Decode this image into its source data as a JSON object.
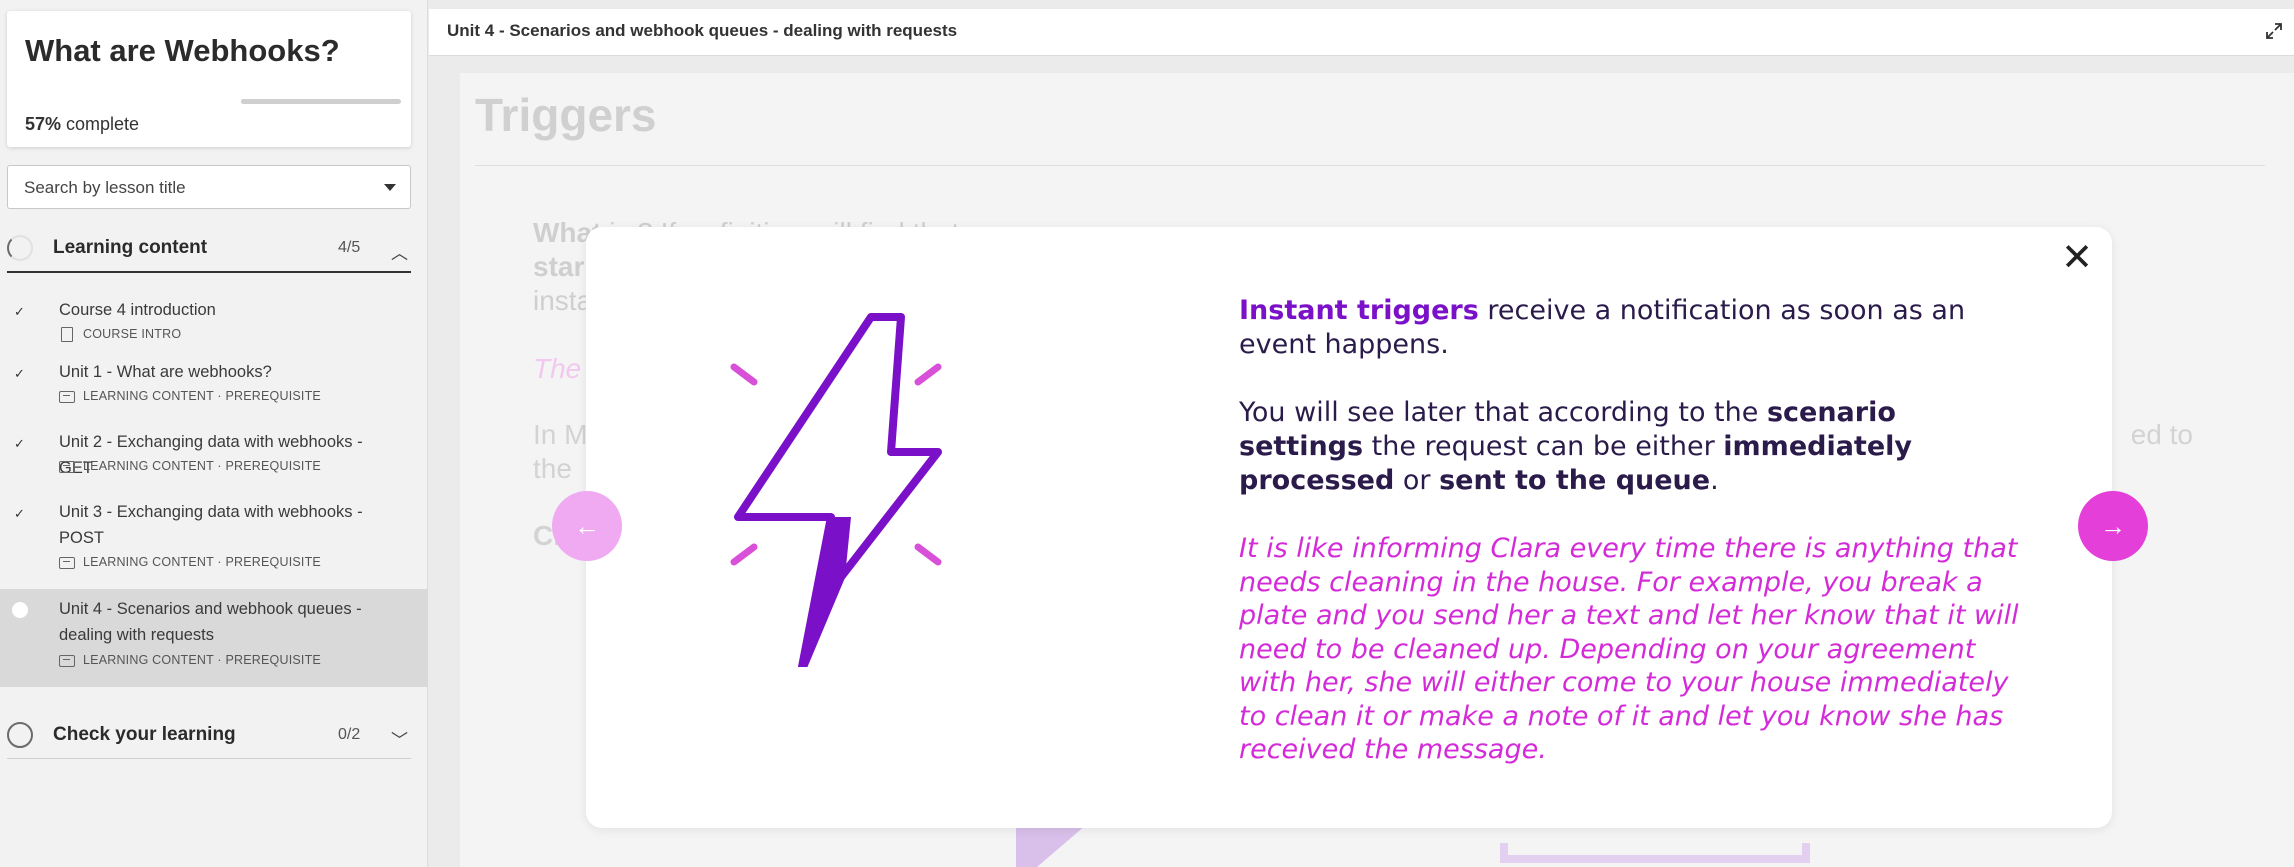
{
  "sidebar": {
    "course_title": "What are Webhooks?",
    "progress_percent": 57,
    "progress_value": "57%",
    "progress_suffix": " complete",
    "search_placeholder": "Search by lesson title",
    "sections": [
      {
        "label": "Learning content",
        "count": "4/5",
        "chevron": "chevron-up-icon",
        "chevron_glyph": "︿"
      },
      {
        "label": "Check your learning",
        "count": "0/2",
        "chevron": "chevron-down-icon",
        "chevron_glyph": "﹀"
      }
    ],
    "lessons": [
      {
        "title": "Course 4 introduction",
        "meta": "COURSE INTRO",
        "status": "complete",
        "icon": "document-icon"
      },
      {
        "title": "Unit 1 - What are webhooks?",
        "meta": "LEARNING CONTENT · PREREQUISITE",
        "status": "complete",
        "icon": "slides-icon"
      },
      {
        "title": "Unit 2 - Exchanging data with webhooks - GET",
        "meta": "LEARNING CONTENT · PREREQUISITE",
        "status": "complete",
        "icon": "slides-icon"
      },
      {
        "title": "Unit 3 - Exchanging data with webhooks - POST",
        "meta": "LEARNING CONTENT · PREREQUISITE",
        "status": "complete",
        "icon": "slides-icon"
      },
      {
        "title": "Unit 4 - Scenarios and webhook queues - dealing with requests",
        "meta": "LEARNING CONTENT · PREREQUISITE",
        "status": "active",
        "icon": "slides-icon"
      }
    ]
  },
  "topbar": {
    "unit_title": "Unit 4 - Scenarios and webhook queues - dealing with requests"
  },
  "background": {
    "heading": "Triggers",
    "text_1_bold": "What",
    "text_1": "is  ? If  …  finiti  …  will find that  …  ",
    "line_2_start": "star",
    "line_3_start": "insta",
    "pink_line": "The",
    "gray_line_start": "In M",
    "gray_line_end": "ed to",
    "gray_line_2": "the",
    "ci_line": "Ci"
  },
  "modal": {
    "p1_highlight": "Instant triggers",
    "p1_rest": " receive a notification as soon as an event happens.",
    "p2_a": "You will see later that according to the ",
    "p2_b": "scenario settings",
    "p2_c": " the request can be either ",
    "p2_d": "immediately processed",
    "p2_e": " or ",
    "p2_f": "sent to the queue",
    "p2_g": ".",
    "p3": "It is like informing Clara every time there is anything that needs cleaning in the house. For example, you break a plate and you send her a text and let her know that it will need to be cleaned up. Depending on your agreement with her, she will either come to your house immediately to clean it or make a note of it and let you know she has received the message.",
    "close_glyph": "✕",
    "prev_glyph": "←",
    "next_glyph": "→"
  },
  "colors": {
    "accent_purple": "#7a10c8",
    "accent_pink": "#e43fd8",
    "prev_button": "#efaaf2",
    "text_dark": "#2a1b4a"
  }
}
